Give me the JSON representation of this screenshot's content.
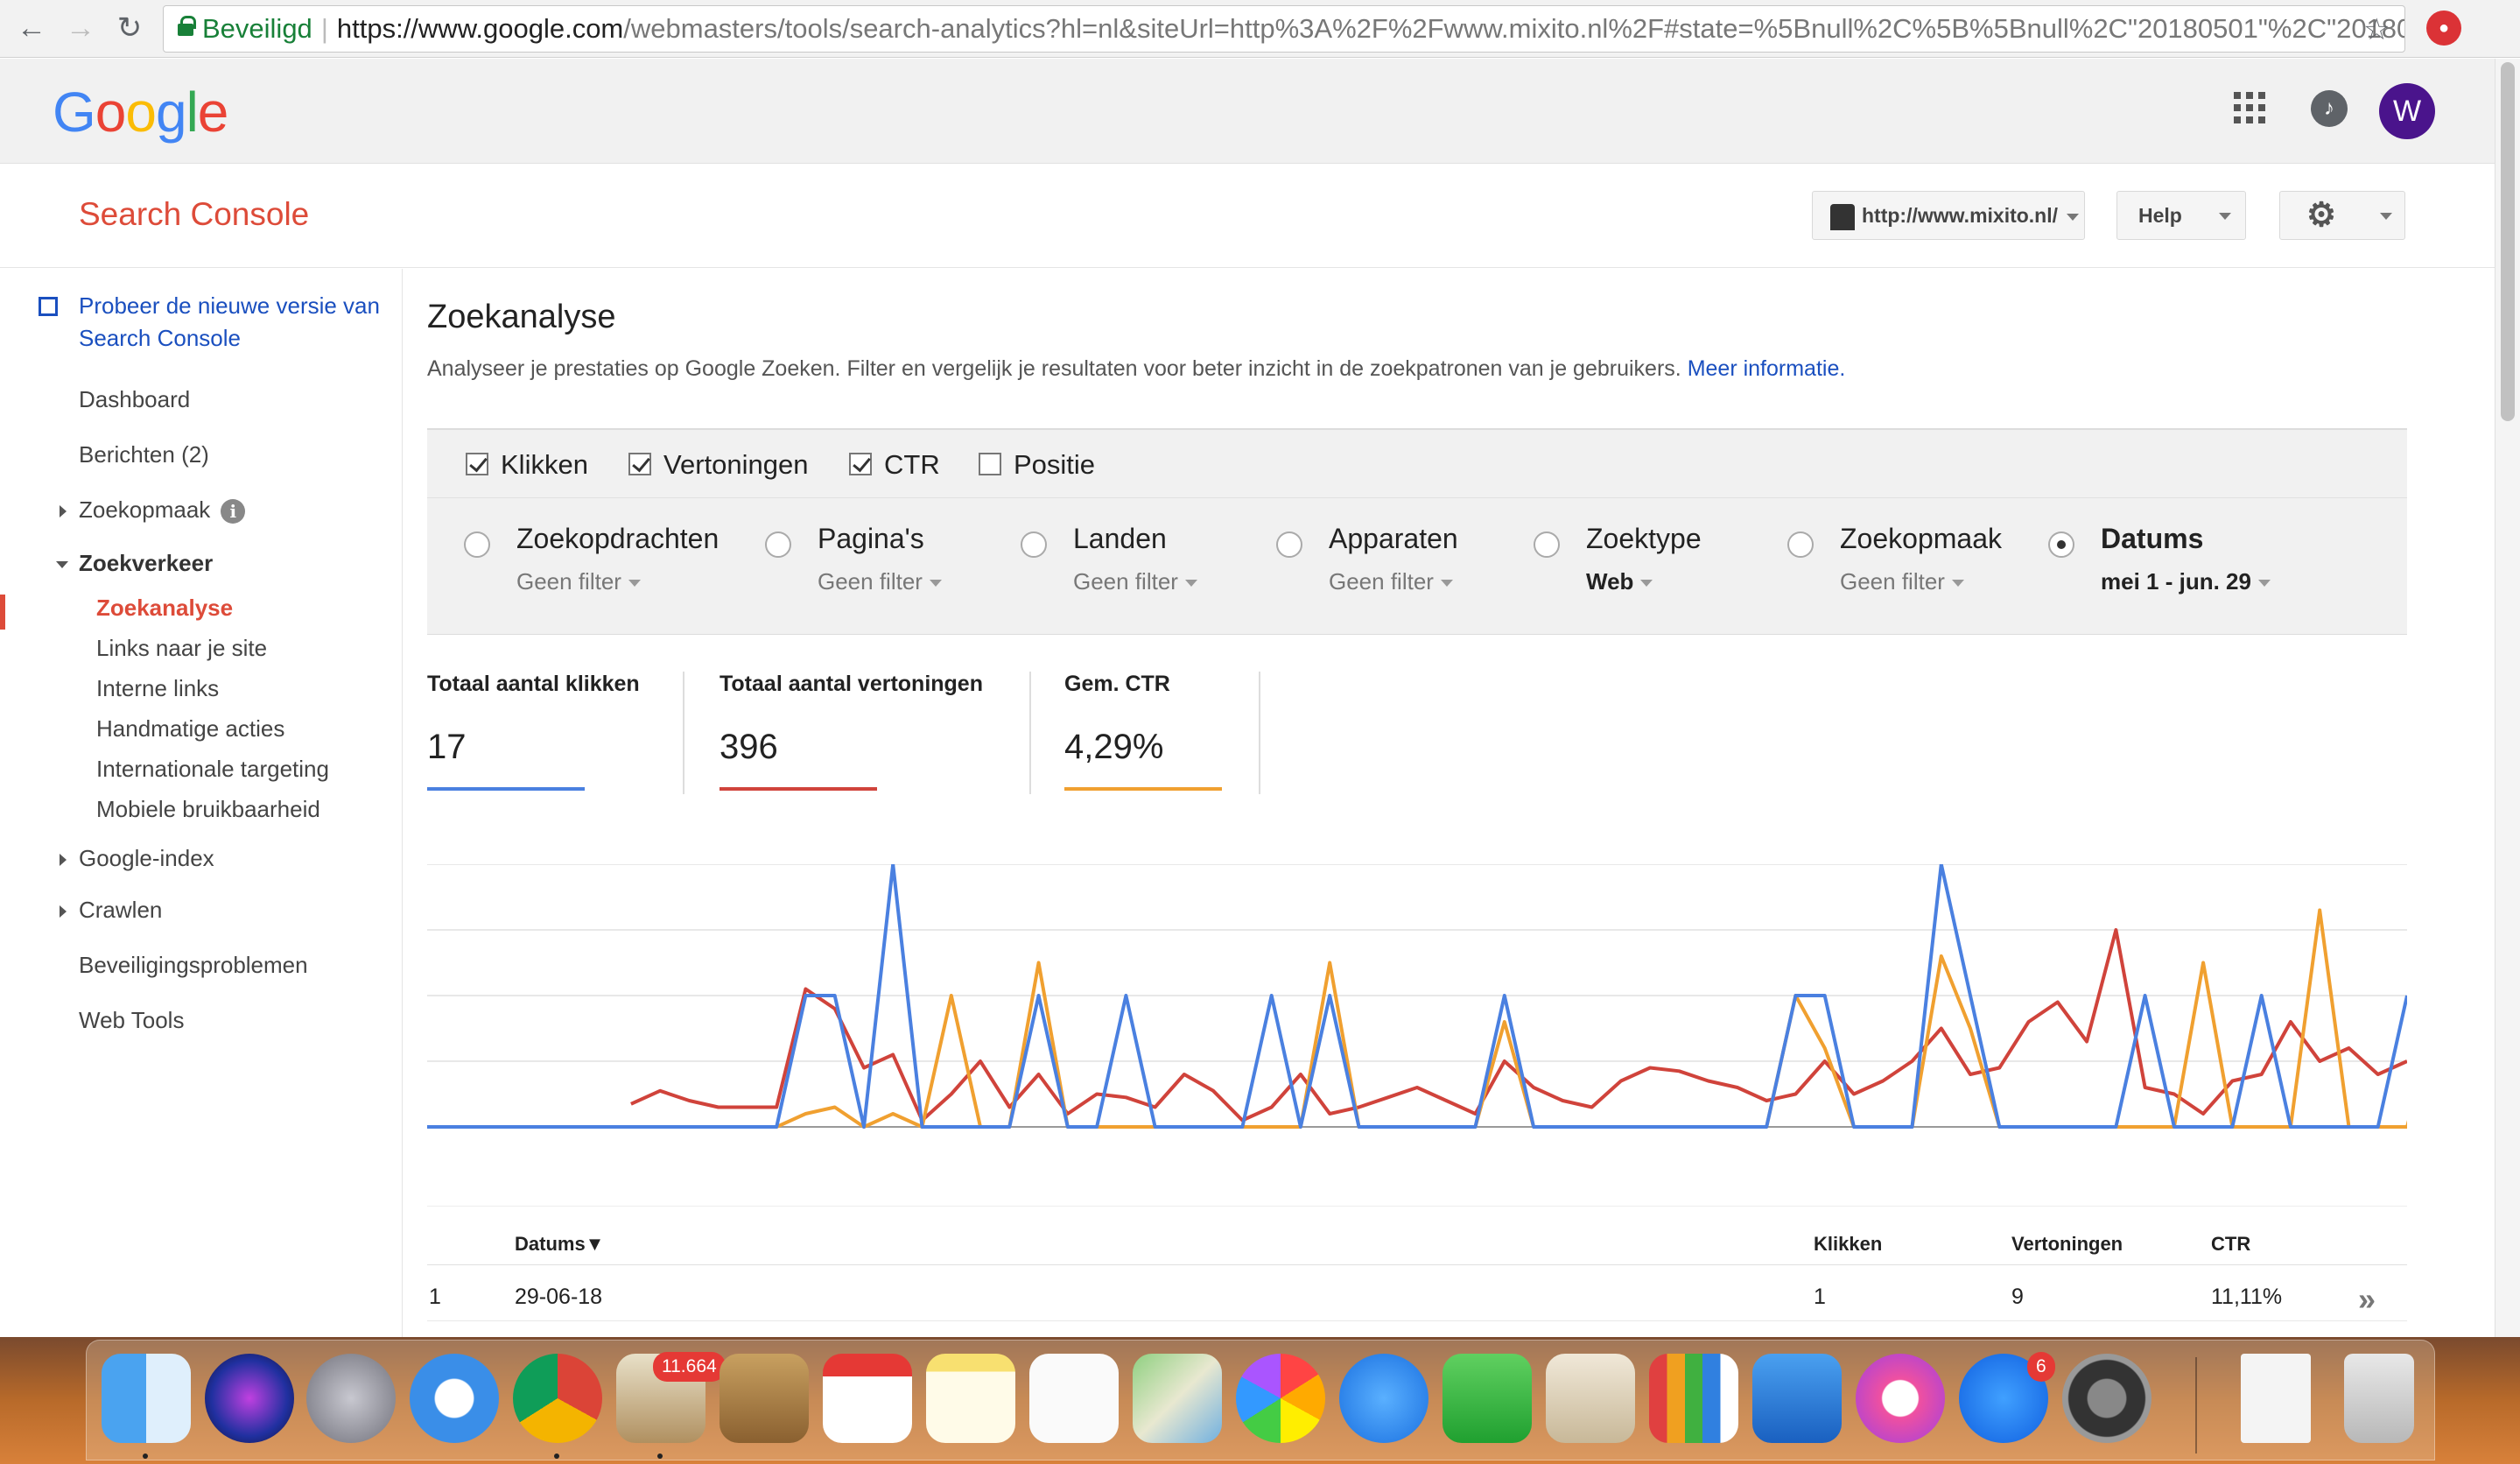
{
  "browser": {
    "secure_label": "Beveiligd",
    "url_host": "https://www.google.com",
    "url_path": "/webmasters/tools/search-analytics?hl=nl&siteUrl=http%3A%2F%2Fwww.mixito.nl%2F#state=%5Bnull%2C%5B%5Bnull%2C\"20180501\"%2C\"20180629\"..."
  },
  "header": {
    "logo": [
      "G",
      "o",
      "o",
      "g",
      "l",
      "e"
    ],
    "logo_colors": [
      "#4285f4",
      "#ea4335",
      "#fbbc05",
      "#4285f4",
      "#34a853",
      "#ea4335"
    ],
    "avatar_letter": "W"
  },
  "console": {
    "title": "Search Console",
    "site": "http://www.mixito.nl/",
    "help": "Help"
  },
  "sidebar": {
    "promo": "Probeer de nieuwe versie van Search Console",
    "items": [
      {
        "label": "Dashboard"
      },
      {
        "label": "Berichten (2)"
      },
      {
        "label": "Zoekopmaak"
      },
      {
        "label": "Zoekverkeer"
      },
      {
        "label": "Zoekanalyse"
      },
      {
        "label": "Links naar je site"
      },
      {
        "label": "Interne links"
      },
      {
        "label": "Handmatige acties"
      },
      {
        "label": "Internationale targeting"
      },
      {
        "label": "Mobiele bruikbaarheid"
      },
      {
        "label": "Google-index"
      },
      {
        "label": "Crawlen"
      },
      {
        "label": "Beveiligingsproblemen"
      },
      {
        "label": "Web Tools"
      }
    ],
    "info_glyph": "i"
  },
  "main": {
    "title": "Zoekanalyse",
    "description": "Analyseer je prestaties op Google Zoeken. Filter en vergelijk je resultaten voor beter inzicht in de zoekpatronen van je gebruikers.",
    "more_link": "Meer informatie.",
    "metrics": [
      {
        "label": "Klikken",
        "checked": true
      },
      {
        "label": "Vertoningen",
        "checked": true
      },
      {
        "label": "CTR",
        "checked": true
      },
      {
        "label": "Positie",
        "checked": false
      }
    ],
    "groups": [
      {
        "label": "Zoekopdrachten",
        "filter": "Geen filter",
        "selected": false
      },
      {
        "label": "Pagina's",
        "filter": "Geen filter",
        "selected": false
      },
      {
        "label": "Landen",
        "filter": "Geen filter",
        "selected": false
      },
      {
        "label": "Apparaten",
        "filter": "Geen filter",
        "selected": false
      },
      {
        "label": "Zoektype",
        "filter": "Web",
        "selected": false
      },
      {
        "label": "Zoekopmaak",
        "filter": "Geen filter",
        "selected": false
      },
      {
        "label": "Datums",
        "filter": "mei 1 - jun. 29",
        "selected": true
      }
    ],
    "totals": [
      {
        "label": "Totaal aantal klikken",
        "value": "17",
        "color": "#4a80e0"
      },
      {
        "label": "Totaal aantal vertoningen",
        "value": "396",
        "color": "#d0433b"
      },
      {
        "label": "Gem. CTR",
        "value": "4,29%",
        "color": "#f0a030"
      }
    ],
    "table": {
      "headers": [
        "Datums▼",
        "Klikken",
        "Vertoningen",
        "CTR"
      ],
      "rows": [
        {
          "index": "1",
          "date": "29-06-18",
          "clicks": "1",
          "impressions": "9",
          "ctr": "11,11%"
        }
      ],
      "more_glyph": "»"
    }
  },
  "chart_data": {
    "type": "line",
    "grid": true,
    "series": [
      {
        "color": "#4a80e0",
        "values": [
          0,
          0,
          0,
          0,
          0,
          0,
          0,
          0,
          0,
          0,
          0,
          0,
          0,
          2,
          2,
          0,
          4,
          0,
          0,
          0,
          0,
          2,
          0,
          0,
          2,
          0,
          0,
          0,
          0,
          2,
          0,
          2,
          0,
          0,
          0,
          0,
          0,
          2,
          0,
          0,
          0,
          0,
          0,
          0,
          0,
          0,
          0,
          2,
          2,
          0,
          0,
          0,
          4,
          2,
          0,
          0,
          0,
          0,
          0,
          2,
          0,
          0,
          0,
          2,
          0,
          0,
          0,
          0,
          2
        ]
      },
      {
        "color": "#d0433b",
        "values": [
          null,
          null,
          null,
          null,
          null,
          null,
          null,
          0.35,
          0.55,
          0.4,
          0.3,
          0.3,
          0.3,
          2.1,
          1.8,
          0.9,
          1.1,
          0.1,
          0.5,
          1.0,
          0.3,
          0.8,
          0.2,
          0.5,
          0.45,
          0.3,
          0.8,
          0.55,
          0.1,
          0.3,
          0.8,
          0.2,
          0.3,
          0.45,
          0.6,
          0.4,
          0.2,
          1.0,
          0.6,
          0.4,
          0.3,
          0.7,
          0.9,
          0.85,
          0.7,
          0.6,
          0.4,
          0.5,
          1.0,
          0.5,
          0.7,
          1.0,
          1.5,
          0.8,
          0.9,
          1.6,
          1.9,
          1.3,
          3.0,
          0.6,
          0.5,
          0.2,
          0.7,
          0.8,
          1.6,
          1.0,
          1.2,
          0.8,
          1.0
        ]
      },
      {
        "color": "#f0a030",
        "values": [
          null,
          null,
          null,
          null,
          null,
          null,
          null,
          0,
          0,
          0,
          0,
          0,
          0,
          0.2,
          0.3,
          0,
          0.2,
          0,
          2.0,
          0,
          0,
          2.5,
          0,
          0,
          0,
          0,
          0,
          0,
          0,
          0,
          0,
          2.5,
          0,
          0,
          0,
          0,
          0,
          1.6,
          0,
          0,
          0,
          0,
          0,
          0,
          0,
          0,
          0,
          2,
          1.2,
          0,
          0,
          0,
          2.6,
          1.5,
          0,
          0,
          0,
          0,
          0,
          0,
          0,
          2.5,
          0,
          0,
          0,
          3.3,
          0,
          0,
          0,
          1.7
        ]
      }
    ],
    "ylim": [
      0,
      4
    ]
  }
}
